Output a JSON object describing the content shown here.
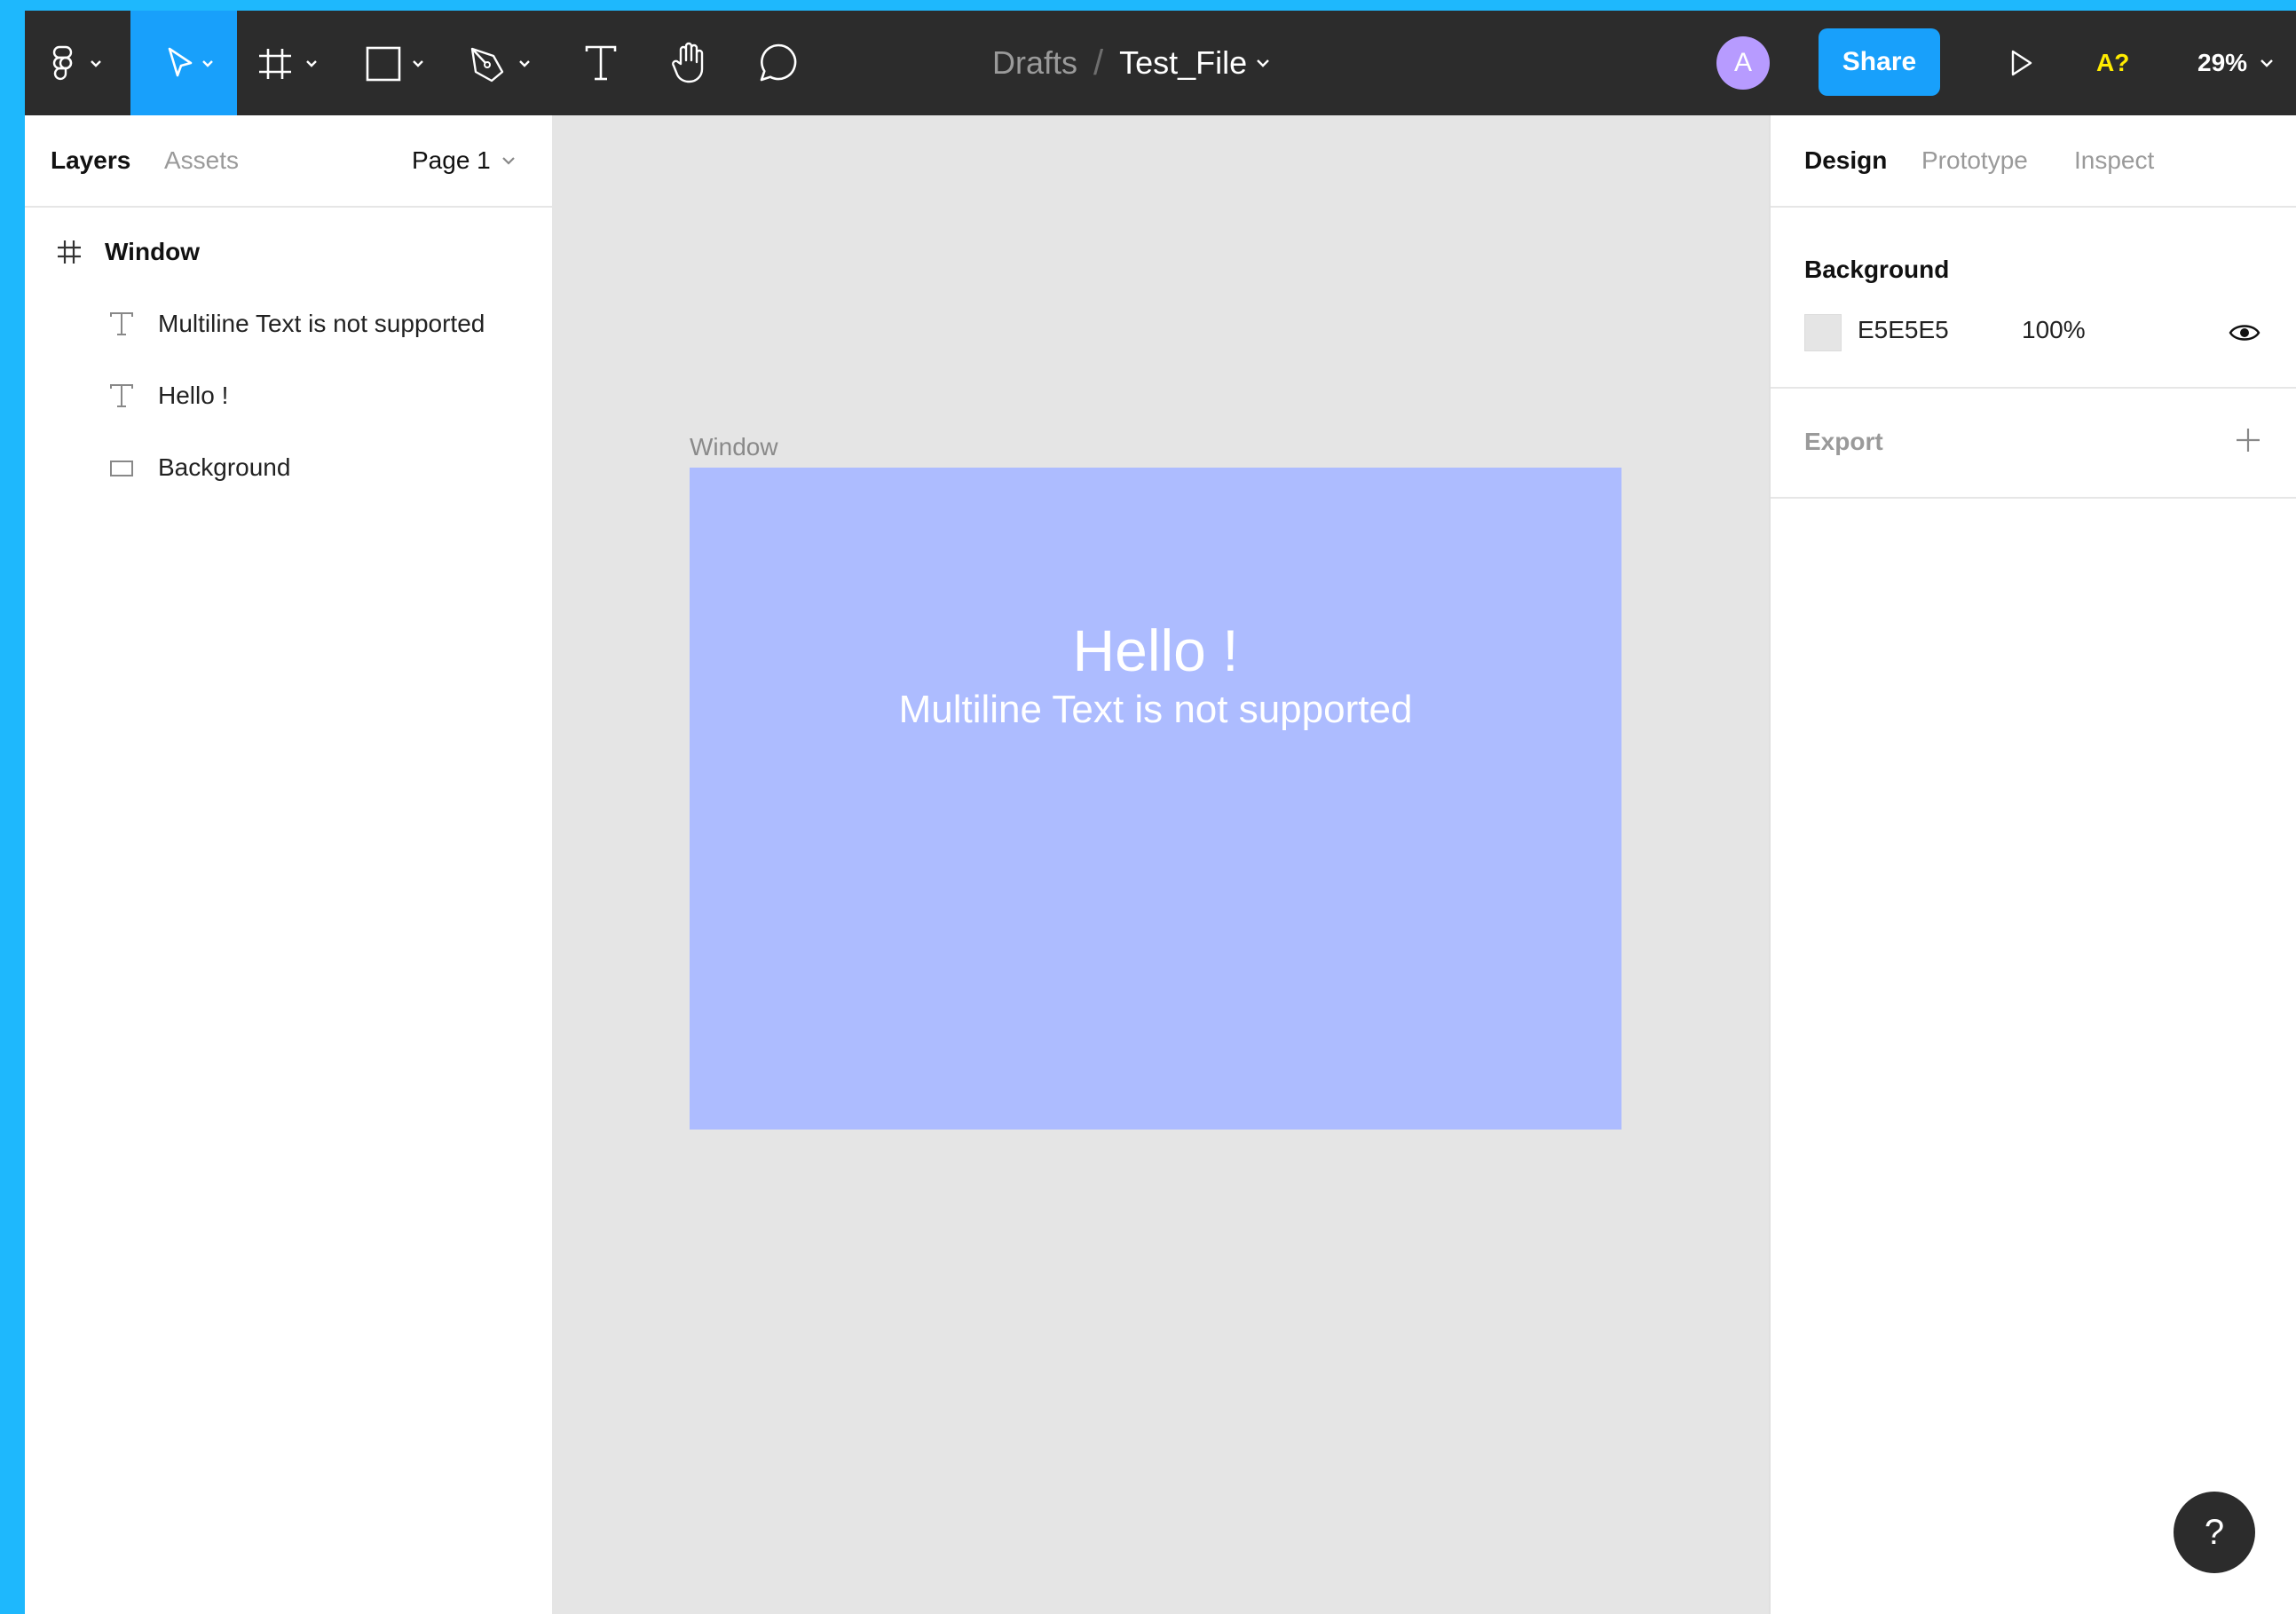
{
  "toolbar": {
    "breadcrumb_parent": "Drafts",
    "breadcrumb_separator": "/",
    "file_name": "Test_File",
    "avatar_initial": "A",
    "share_label": "Share",
    "accessibility_label": "A?",
    "zoom_level": "29%",
    "tools": [
      "main-menu",
      "move",
      "frame",
      "rectangle",
      "pen",
      "text",
      "hand",
      "comment"
    ],
    "active_tool": "move",
    "colors": {
      "bar": "#2c2c2c",
      "accent": "#18a0fb",
      "avatar": "#b79bff",
      "a11y": "#ffeb00"
    }
  },
  "left_panel": {
    "tabs": [
      "Layers",
      "Assets"
    ],
    "active_tab": "Layers",
    "page_selector": "Page 1",
    "layers": [
      {
        "name": "Window",
        "type": "frame"
      },
      {
        "name": "Multiline Text is not supported",
        "type": "text"
      },
      {
        "name": "Hello !",
        "type": "text"
      },
      {
        "name": "Background",
        "type": "rectangle"
      }
    ]
  },
  "canvas": {
    "frame_label": "Window",
    "heading": "Hello !",
    "subheading": "Multiline Text is not supported",
    "frame_color": "#adbcff",
    "canvas_color": "#e5e5e5"
  },
  "right_panel": {
    "tabs": [
      "Design",
      "Prototype",
      "Inspect"
    ],
    "active_tab": "Design",
    "background_title": "Background",
    "background_hex": "E5E5E5",
    "background_opacity": "100%",
    "export_title": "Export"
  },
  "help_label": "?"
}
